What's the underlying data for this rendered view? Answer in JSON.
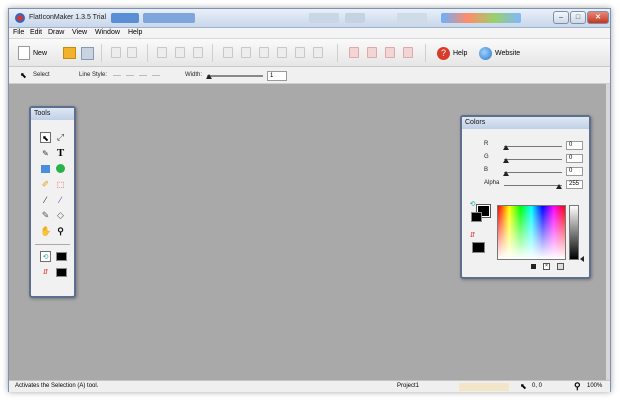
{
  "window": {
    "title": "FlatIconMaker 1.3.5 Trial"
  },
  "menu": [
    "File",
    "Edit",
    "Draw",
    "View",
    "Window",
    "Help"
  ],
  "toolbar": {
    "new_label": "New",
    "help_label": "Help",
    "website_label": "Website"
  },
  "options": {
    "select_label": "Select",
    "line_style_label": "Line Style:",
    "width_label": "Width:",
    "width_value": "1"
  },
  "tools": {
    "title": "Tools",
    "items": [
      "selection-arrow",
      "node-edit",
      "pen",
      "text",
      "rectangle",
      "ellipse",
      "pencil",
      "crop",
      "eyedropper",
      "fill",
      "brush",
      "shape",
      "hand",
      "zoom"
    ]
  },
  "colors": {
    "title": "Colors",
    "r_label": "R",
    "g_label": "G",
    "b_label": "B",
    "alpha_label": "Alpha",
    "r": "0",
    "g": "0",
    "b": "0",
    "alpha": "255"
  },
  "status": {
    "message": "Activates the Selection (A) tool.",
    "project": "Project1",
    "coords": "0, 0",
    "zoom": "100%"
  }
}
